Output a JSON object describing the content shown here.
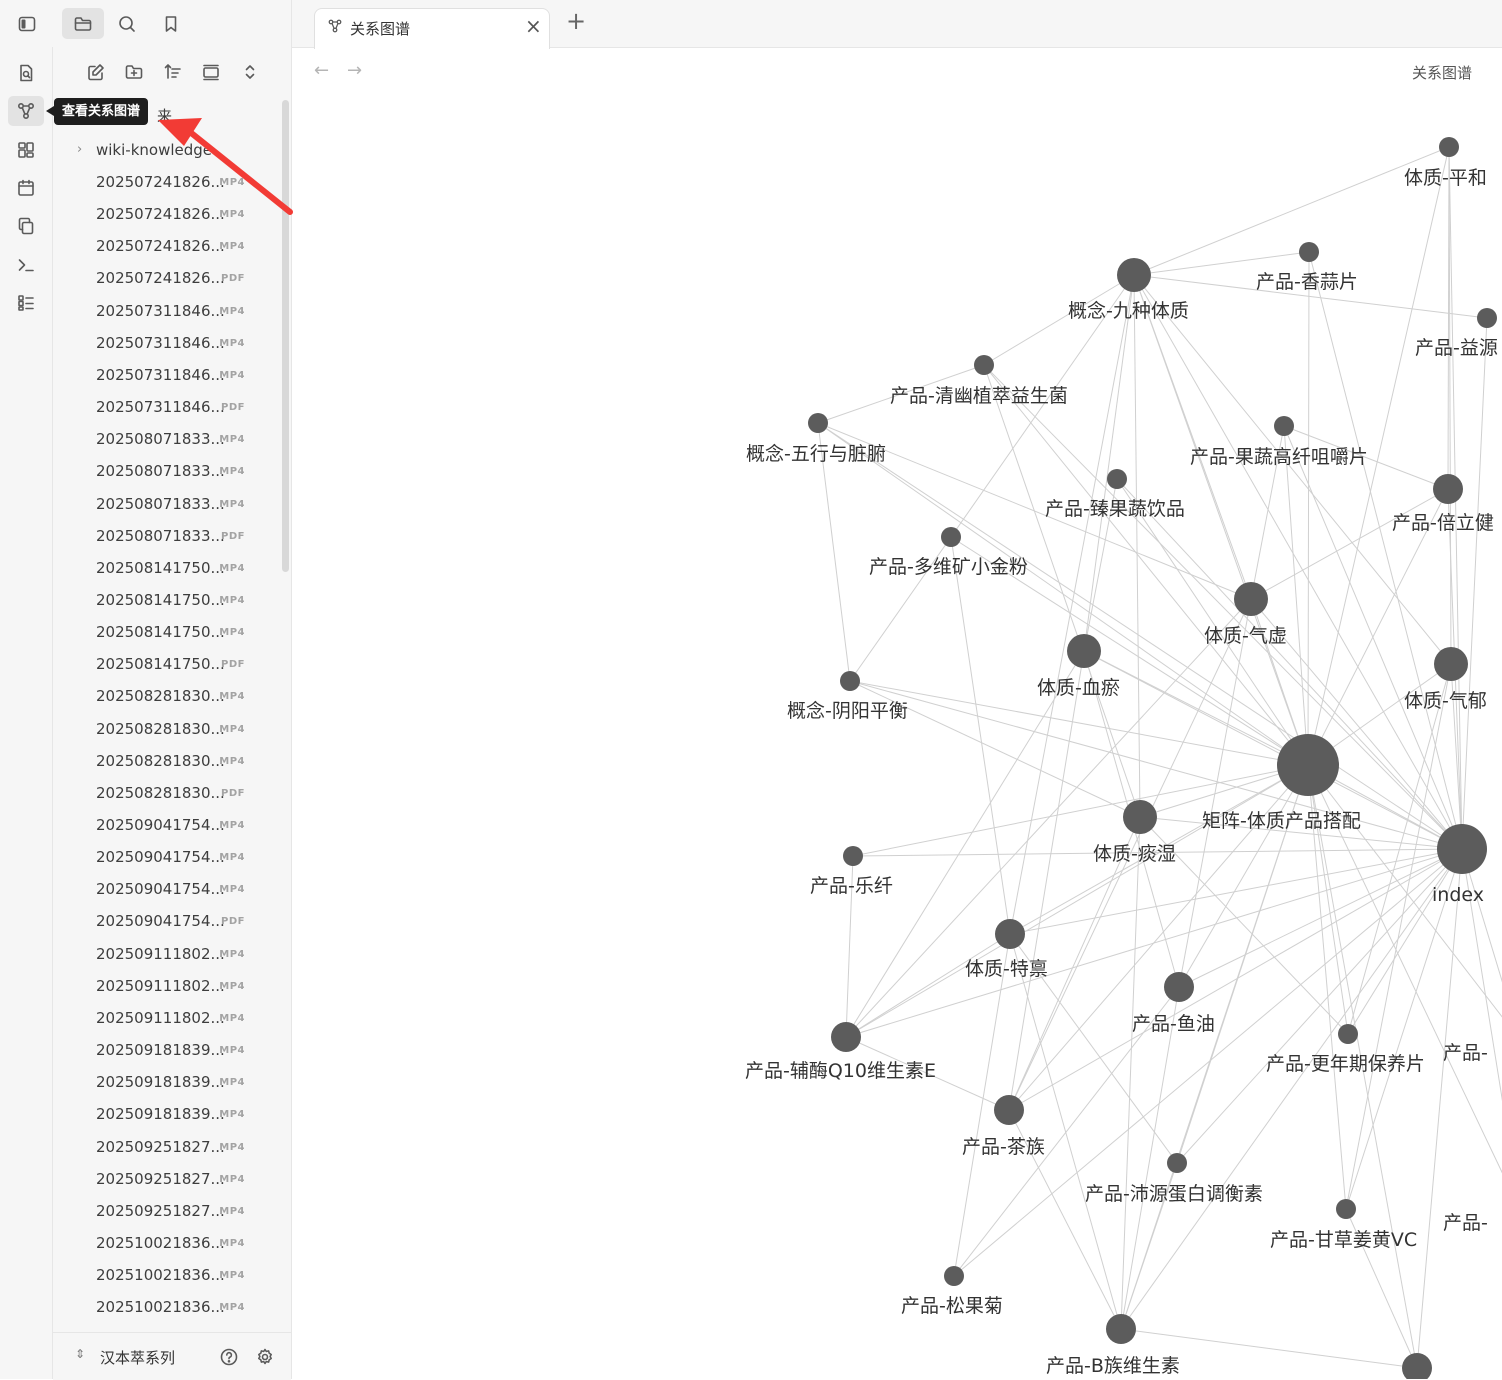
{
  "ribbon": {
    "top_icons": [
      "sidebar-toggle-icon",
      "folder-icon",
      "search-icon",
      "bookmark-icon"
    ],
    "side_icons": [
      "quick-switcher-icon",
      "graph-icon",
      "canvas-icon",
      "calendar-icon",
      "copy-icon",
      "terminal-icon",
      "outline-icon"
    ]
  },
  "tooltip": {
    "text": "查看关系图谱"
  },
  "explorer": {
    "toolbar_icons": [
      "new-note-icon",
      "new-folder-icon",
      "sort-icon",
      "collapse-icon",
      "expand-collapse-icon"
    ],
    "partial_folder": "来",
    "folder": {
      "name": "wiki-knowledge"
    },
    "files": [
      {
        "name": "202507241826...",
        "ext": "MP4"
      },
      {
        "name": "202507241826...",
        "ext": "MP4"
      },
      {
        "name": "202507241826...",
        "ext": "MP4"
      },
      {
        "name": "202507241826...",
        "ext": "PDF"
      },
      {
        "name": "202507311846...",
        "ext": "MP4"
      },
      {
        "name": "202507311846...",
        "ext": "MP4"
      },
      {
        "name": "202507311846...",
        "ext": "MP4"
      },
      {
        "name": "202507311846...",
        "ext": "PDF"
      },
      {
        "name": "202508071833...",
        "ext": "MP4"
      },
      {
        "name": "202508071833...",
        "ext": "MP4"
      },
      {
        "name": "202508071833...",
        "ext": "MP4"
      },
      {
        "name": "202508071833...",
        "ext": "PDF"
      },
      {
        "name": "202508141750...",
        "ext": "MP4"
      },
      {
        "name": "202508141750...",
        "ext": "MP4"
      },
      {
        "name": "202508141750...",
        "ext": "MP4"
      },
      {
        "name": "202508141750...",
        "ext": "PDF"
      },
      {
        "name": "202508281830...",
        "ext": "MP4"
      },
      {
        "name": "202508281830...",
        "ext": "MP4"
      },
      {
        "name": "202508281830...",
        "ext": "MP4"
      },
      {
        "name": "202508281830...",
        "ext": "PDF"
      },
      {
        "name": "202509041754...",
        "ext": "MP4"
      },
      {
        "name": "202509041754...",
        "ext": "MP4"
      },
      {
        "name": "202509041754...",
        "ext": "MP4"
      },
      {
        "name": "202509041754...",
        "ext": "PDF"
      },
      {
        "name": "202509111802...",
        "ext": "MP4"
      },
      {
        "name": "202509111802...",
        "ext": "MP4"
      },
      {
        "name": "202509111802...",
        "ext": "MP4"
      },
      {
        "name": "202509181839...",
        "ext": "MP4"
      },
      {
        "name": "202509181839...",
        "ext": "MP4"
      },
      {
        "name": "202509181839...",
        "ext": "MP4"
      },
      {
        "name": "202509251827...",
        "ext": "MP4"
      },
      {
        "name": "202509251827...",
        "ext": "MP4"
      },
      {
        "name": "202509251827...",
        "ext": "MP4"
      },
      {
        "name": "202510021836...",
        "ext": "MP4"
      },
      {
        "name": "202510021836...",
        "ext": "MP4"
      },
      {
        "name": "202510021836...",
        "ext": "MP4"
      }
    ]
  },
  "vault": {
    "name": "汉本萃系列",
    "help_icon": "help-icon",
    "settings_icon": "gear-icon"
  },
  "tab": {
    "title": "关系图谱",
    "close": "×",
    "new_tab": "+"
  },
  "view": {
    "title": "关系图谱",
    "back_icon": "arrow-left-icon",
    "forward_icon": "arrow-right-icon"
  },
  "graph": {
    "node_color": "#5c5c5c",
    "edge_color": "#d0d0d0",
    "nodes": [
      {
        "id": "pinghe",
        "label": "体质-平和",
        "weight": 2
      },
      {
        "id": "jiuzhong",
        "label": "概念-九种体质",
        "weight": 4
      },
      {
        "id": "xiangsuan",
        "label": "产品-香蒜片",
        "weight": 2
      },
      {
        "id": "yiyuan",
        "label": "产品-益源",
        "weight": 2
      },
      {
        "id": "qingyou",
        "label": "产品-清幽植萃益生菌",
        "weight": 2
      },
      {
        "id": "wuxing",
        "label": "概念-五行与脏腑",
        "weight": 2
      },
      {
        "id": "guoshu",
        "label": "产品-果蔬高纤咀嚼片",
        "weight": 2
      },
      {
        "id": "zhenguo",
        "label": "产品-臻果蔬饮品",
        "weight": 2
      },
      {
        "id": "beilijian",
        "label": "产品-倍立健",
        "weight": 3
      },
      {
        "id": "duowei",
        "label": "产品-多维矿小金粉",
        "weight": 2
      },
      {
        "id": "qixu",
        "label": "体质-气虚",
        "weight": 4
      },
      {
        "id": "xueyu",
        "label": "体质-血瘀",
        "weight": 4
      },
      {
        "id": "qiyu",
        "label": "体质-气郁",
        "weight": 4
      },
      {
        "id": "yinyang",
        "label": "概念-阴阳平衡",
        "weight": 2
      },
      {
        "id": "juzhen",
        "label": "矩阵-体质产品搭配",
        "weight": 10
      },
      {
        "id": "tanshi",
        "label": "体质-痰湿",
        "weight": 4
      },
      {
        "id": "index",
        "label": "index",
        "weight": 8
      },
      {
        "id": "lexian",
        "label": "产品-乐纤",
        "weight": 2
      },
      {
        "id": "tebing",
        "label": "体质-特禀",
        "weight": 3
      },
      {
        "id": "yuyou",
        "label": "产品-鱼油",
        "weight": 3
      },
      {
        "id": "gengnian",
        "label": "产品-更年期保养片",
        "weight": 2
      },
      {
        "id": "fumei",
        "label": "产品-辅酶Q10维生素E",
        "weight": 3
      },
      {
        "id": "chazu",
        "label": "产品-茶族",
        "weight": 3
      },
      {
        "id": "peiyuan",
        "label": "产品-沛源蛋白调衡素",
        "weight": 2
      },
      {
        "id": "gancao",
        "label": "产品-甘草姜黄VC",
        "weight": 2
      },
      {
        "id": "songguo",
        "label": "产品-松果菊",
        "weight": 2
      },
      {
        "id": "bzu",
        "label": "产品-B族维生素",
        "weight": 3
      },
      {
        "id": "right1",
        "label": "产品-",
        "weight": 2
      },
      {
        "id": "right2",
        "label": "产品-",
        "weight": 2
      },
      {
        "id": "bottom",
        "label": "",
        "weight": 3
      }
    ]
  }
}
